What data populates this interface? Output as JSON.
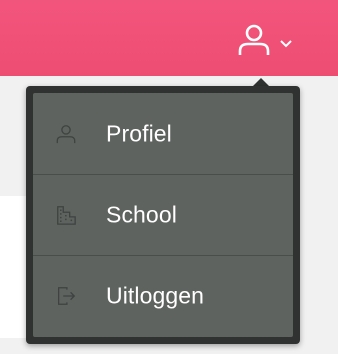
{
  "header": {
    "user_icon": "person-outline-icon",
    "chevron_icon": "chevron-down-icon",
    "accent_color": "#f2557c"
  },
  "user_menu": {
    "items": [
      {
        "label": "Profiel",
        "icon": "user-icon"
      },
      {
        "label": "School",
        "icon": "building-icon"
      },
      {
        "label": "Uitloggen",
        "icon": "logout-icon"
      }
    ],
    "background_color": "#5e635f",
    "border_color": "#2f3230",
    "text_color": "#ffffff"
  }
}
